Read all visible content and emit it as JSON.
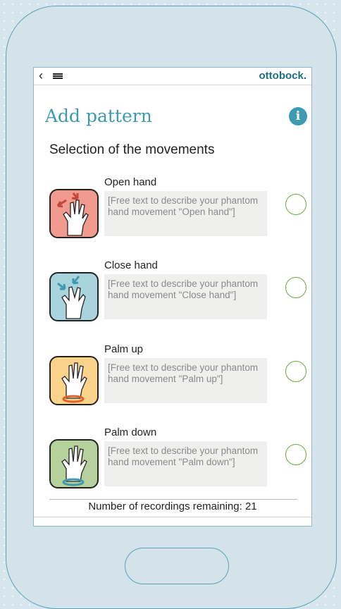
{
  "header": {
    "brand": "ottobock.",
    "back_icon": "chevron-left-icon",
    "menu_icon": "hamburger-menu-icon"
  },
  "page": {
    "title": "Add pattern",
    "info_icon": "info-icon",
    "subtitle": "Selection of the movements"
  },
  "movements": [
    {
      "title": "Open hand",
      "description": "[Free text to describe your phantom hand movement \"Open hand\"]",
      "icon": "open-hand-icon",
      "icon_bg": "#f19a8f",
      "selected": false
    },
    {
      "title": "Close hand",
      "description": "[Free text to describe your phantom hand movement \"Close hand\"]",
      "icon": "close-hand-icon",
      "icon_bg": "#a9d3dd",
      "selected": false
    },
    {
      "title": "Palm up",
      "description": "[Free text to describe your phantom hand movement \"Palm up\"]",
      "icon": "palm-up-icon",
      "icon_bg": "#fbd38a",
      "selected": false
    },
    {
      "title": "Palm down",
      "description": "[Free text to describe your phantom hand movement \"Palm down\"]",
      "icon": "palm-down-icon",
      "icon_bg": "#b6d19b",
      "selected": false
    }
  ],
  "footer": {
    "remaining_text": "Number of recordings remaining: 21"
  },
  "colors": {
    "accent": "#3e9ab0",
    "radio": "#6ea83c",
    "brand": "#1d6f82"
  }
}
